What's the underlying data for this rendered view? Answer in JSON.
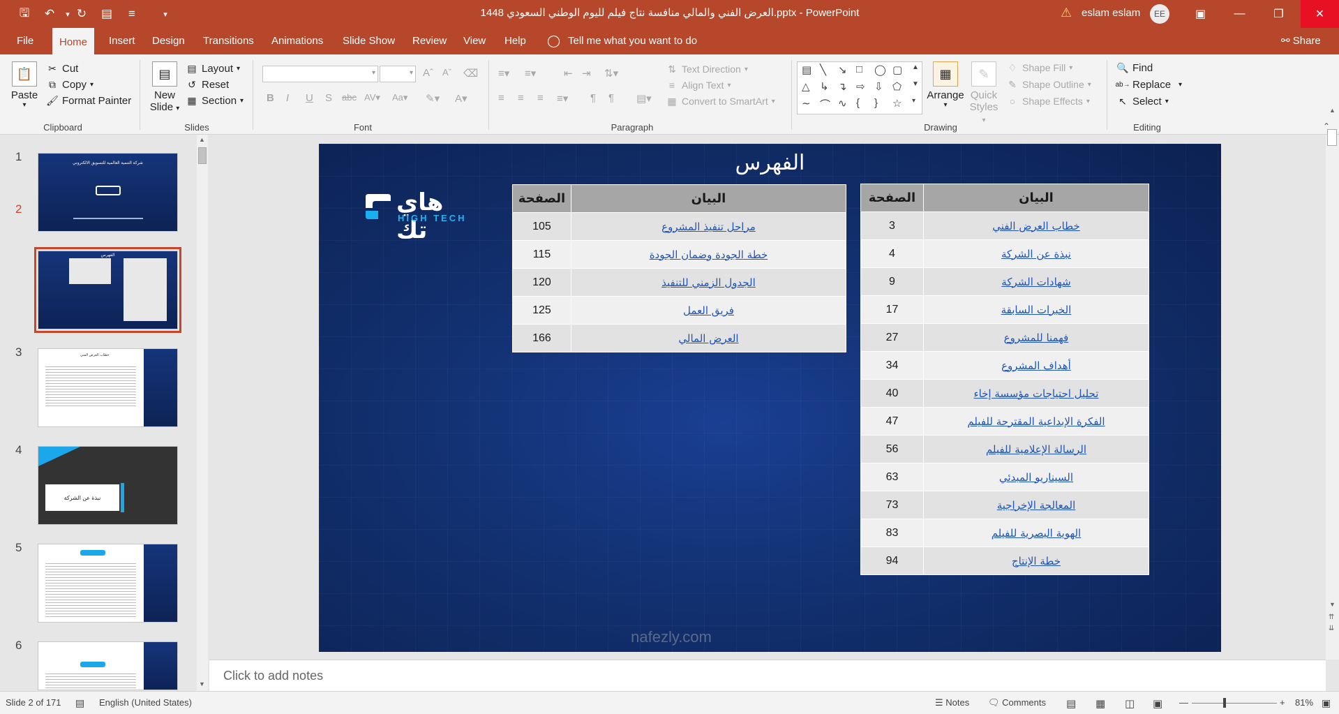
{
  "window": {
    "title": "العرض الفني والمالي منافسة نتاج فيلم لليوم الوطني السعودي 1448.pptx  -  PowerPoint",
    "user_name": "eslam eslam",
    "user_initials": "EE"
  },
  "tabs": [
    "File",
    "Home",
    "Insert",
    "Design",
    "Transitions",
    "Animations",
    "Slide Show",
    "Review",
    "View",
    "Help"
  ],
  "active_tab": "Home",
  "tell_me": "Tell me what you want to do",
  "share": "Share",
  "ribbon": {
    "clipboard": {
      "label": "Clipboard",
      "paste": "Paste",
      "cut": "Cut",
      "copy": "Copy",
      "format_painter": "Format Painter"
    },
    "slides": {
      "label": "Slides",
      "new_slide_line1": "New",
      "new_slide_line2": "Slide",
      "layout": "Layout",
      "reset": "Reset",
      "section": "Section"
    },
    "font": {
      "label": "Font"
    },
    "paragraph": {
      "label": "Paragraph",
      "text_direction": "Text Direction",
      "align_text": "Align Text",
      "convert_smartart": "Convert to SmartArt"
    },
    "drawing": {
      "label": "Drawing",
      "arrange": "Arrange",
      "quick_styles_line1": "Quick",
      "quick_styles_line2": "Styles",
      "shape_fill": "Shape Fill",
      "shape_outline": "Shape Outline",
      "shape_effects": "Shape Effects"
    },
    "editing": {
      "label": "Editing",
      "find": "Find",
      "replace": "Replace",
      "select": "Select"
    }
  },
  "thumbnails": [
    {
      "num": "1",
      "title": "شركة التنمية العالمية للتسويق الالكتروني"
    },
    {
      "num": "2",
      "title": "الفهرس"
    },
    {
      "num": "3",
      "title": "خطاب العرض الفني"
    },
    {
      "num": "4",
      "title": "نبذة عن الشركة"
    },
    {
      "num": "5",
      "title": ""
    },
    {
      "num": "6",
      "title": ""
    }
  ],
  "slide": {
    "title": "الفهرس",
    "logo_text": "هاي تك",
    "logo_sub": "HIGH TECH",
    "table_right": {
      "header_item": "البيان",
      "header_page": "الصفحة",
      "rows": [
        {
          "item": "خطاب العرض الفني",
          "page": "3"
        },
        {
          "item": "نبذة عن الشركة",
          "page": "4"
        },
        {
          "item": "شهادات الشركة",
          "page": "9"
        },
        {
          "item": "الخبرات السابقة",
          "page": "17"
        },
        {
          "item": "فهمنا للمشروع",
          "page": "27"
        },
        {
          "item": "أهداف المشروع",
          "page": "34"
        },
        {
          "item": "تحليل احتياجات مؤسسة إخاء",
          "page": "40"
        },
        {
          "item": "الفكرة الإبداعية المقترحة للفيلم",
          "page": "47"
        },
        {
          "item": "الرسالة الإعلامية للفيلم",
          "page": "56"
        },
        {
          "item": "السيناريو المبدئي",
          "page": "63"
        },
        {
          "item": "المعالجة الإخراجية",
          "page": "73"
        },
        {
          "item": "الهوية البصرية للفيلم",
          "page": "83"
        },
        {
          "item": "خطة الإنتاج",
          "page": "94"
        }
      ]
    },
    "table_left": {
      "header_item": "البيان",
      "header_page": "الصفحة",
      "rows": [
        {
          "item": "مراحل تنفيذ المشروع",
          "page": "105"
        },
        {
          "item": "خطة الجودة وضمان الجودة",
          "page": "115"
        },
        {
          "item": "الجدول الزمني للتنفيذ",
          "page": "120"
        },
        {
          "item": "فريق العمل",
          "page": "125"
        },
        {
          "item": "العرض المالي",
          "page": "166"
        }
      ]
    }
  },
  "notes_placeholder": "Click to add notes",
  "watermark": "nafezly.com",
  "status": {
    "slide_info": "Slide 2 of 171",
    "language": "English (United States)",
    "notes": "Notes",
    "comments": "Comments",
    "zoom": "81%"
  }
}
